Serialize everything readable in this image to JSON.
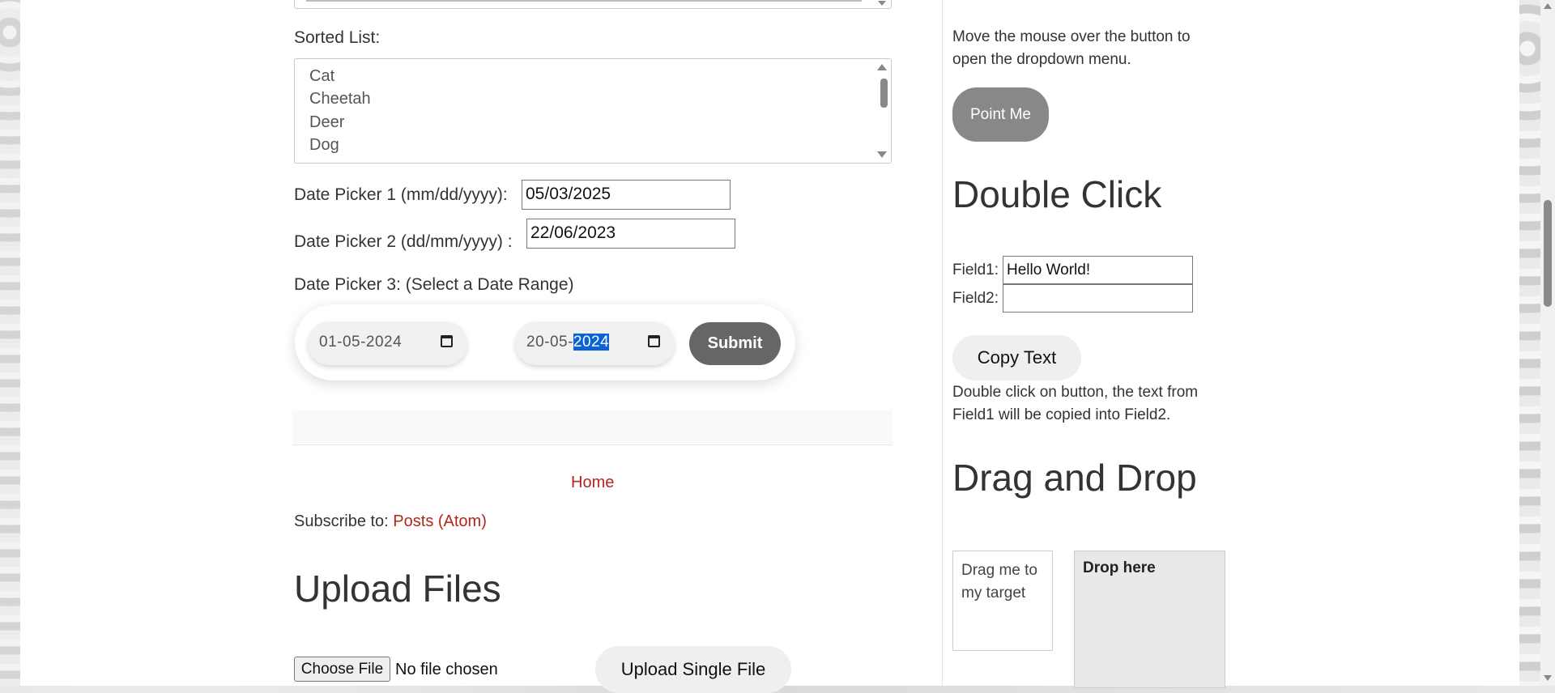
{
  "left": {
    "sorted_list_label": "Sorted List:",
    "sorted_list_items": [
      "Cat",
      "Cheetah",
      "Deer",
      "Dog"
    ],
    "date_picker1_label": "Date Picker 1 (mm/dd/yyyy):",
    "date_picker1_value": "05/03/2025",
    "date_picker2_label": "Date Picker 2 (dd/mm/yyyy) :",
    "date_picker2_value": "22/06/2023",
    "date_picker3_label": "Date Picker 3: (Select a Date Range)",
    "range_start": "01-05-2024",
    "range_end_prefix": "20-05-",
    "range_end_year": "2024",
    "submit_label": "Submit",
    "home_link": "Home",
    "subscribe_label": "Subscribe to:",
    "subscribe_link": "Posts (Atom)",
    "upload_heading": "Upload Files",
    "choose_file_label": "Choose File",
    "no_file_text": "No file chosen",
    "upload_single_label": "Upload Single File"
  },
  "right": {
    "hover_text": "Move the mouse over the button to open the dropdown menu.",
    "point_me_label": "Point Me",
    "double_click_heading": "Double Click",
    "field1_label": "Field1:",
    "field1_value": "Hello World!",
    "field2_label": "Field2:",
    "field2_value": "",
    "copy_text_label": "Copy Text",
    "double_click_hint": "Double click on button, the text from Field1 will be copied into Field2.",
    "drag_drop_heading": "Drag and Drop",
    "drag_text": "Drag me to my target",
    "drop_text": "Drop here"
  },
  "icons": [
    "calendar-icon",
    "scroll-up-arrow-icon",
    "scroll-down-arrow-icon"
  ],
  "colors": {
    "link": "#b3261e",
    "button_dark": "#666666",
    "button_gray": "#888888",
    "selection": "#0a64d6"
  }
}
